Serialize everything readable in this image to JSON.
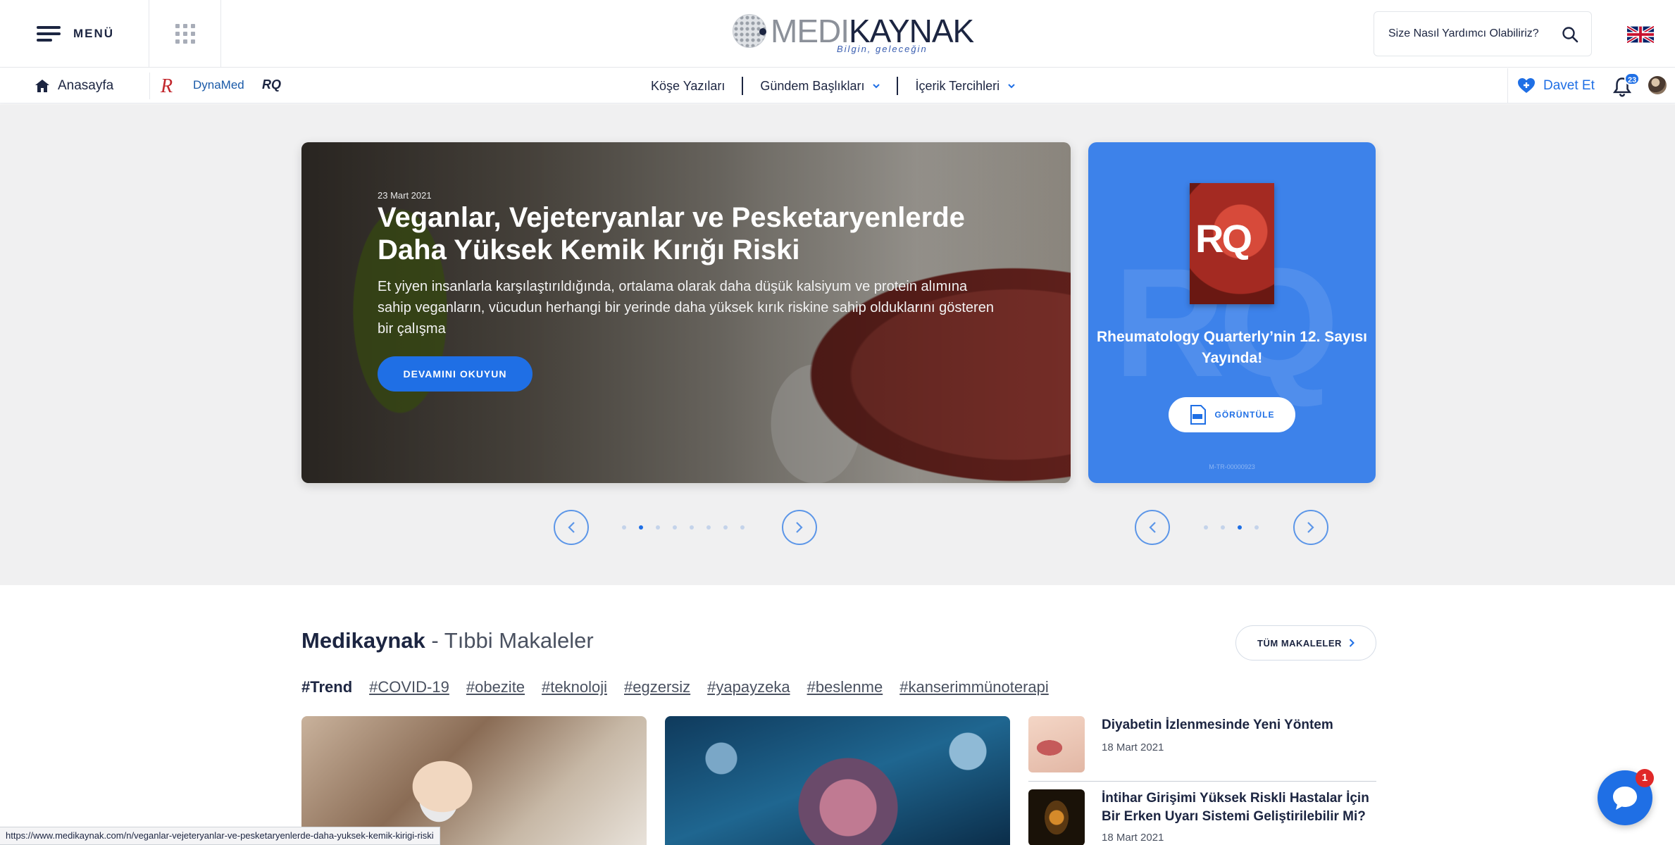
{
  "header": {
    "menu_label": "MENÜ",
    "logo": {
      "medi": "MEDI",
      "kaynak": "KAYNAK",
      "tagline": "Bilgin, geleceğin"
    },
    "help_text": "Size Nasıl Yardımcı Olabiliriz?",
    "language_flag": "uk-flag-icon"
  },
  "subnav": {
    "home_label": "Anasayfa",
    "rx_label": "R",
    "dynamed_label": "DynaMed",
    "rq_label": "RQ",
    "center_items": [
      {
        "label": "Köşe Yazıları"
      },
      {
        "label": "Gündem Başlıkları"
      },
      {
        "label": "İçerik Tercihleri"
      }
    ],
    "invite_label": "Davet Et",
    "notification_count": "23"
  },
  "hero": {
    "date": "23 Mart 2021",
    "title": "Veganlar, Vejeteryanlar ve Pesketaryenlerde Daha Yüksek Kemik Kırığı Riski",
    "description": "Et yiyen insanlarla karşılaştırıldığında, ortalama olarak daha düşük kalsiyum ve protein alımına sahip veganların, vücudun herhangi bir yerinde daha yüksek kırık riskine sahip olduklarını gösteren bir çalışma",
    "button": "DEVAMINI OKUYUN",
    "slide_count": 8,
    "active_slide": 2
  },
  "rq_card": {
    "cover_text": "RQ",
    "title": "Rheumatology Quarterly’nin 12. Sayısı Yayında!",
    "button": "GÖRÜNTÜLE",
    "code": "M-TR-00000923",
    "slide_count": 4,
    "active_slide": 3
  },
  "articles": {
    "title_bold": "Medikaynak",
    "title_rest": " - Tıbbi Makaleler",
    "all_button": "TÜM MAKALELER",
    "trend_label": "#Trend",
    "tags": [
      "#COVID-19",
      "#obezite",
      "#teknoloji",
      "#egzersiz",
      "#yapayzeka",
      "#beslenme",
      "#kanserimmünoterapi"
    ],
    "side_items": [
      {
        "title": "Diyabetin İzlenmesinde Yeni Yöntem",
        "date": "18 Mart 2021"
      },
      {
        "title": "İntihar Girişimi Yüksek Riskli Hastalar İçin Bir Erken Uyarı Sistemi Geliştirilebilir Mi?",
        "date": "18 Mart 2021"
      }
    ]
  },
  "status_url": "https://www.medikaynak.com/n/veganlar-vejeteryanlar-ve-pesketaryenlerde-daha-yuksek-kemik-kirigi-riski",
  "chat_badge": "1",
  "colors": {
    "accent": "#1f6fe5",
    "navy": "#1c2541",
    "rq_blue": "#3d82ea"
  }
}
